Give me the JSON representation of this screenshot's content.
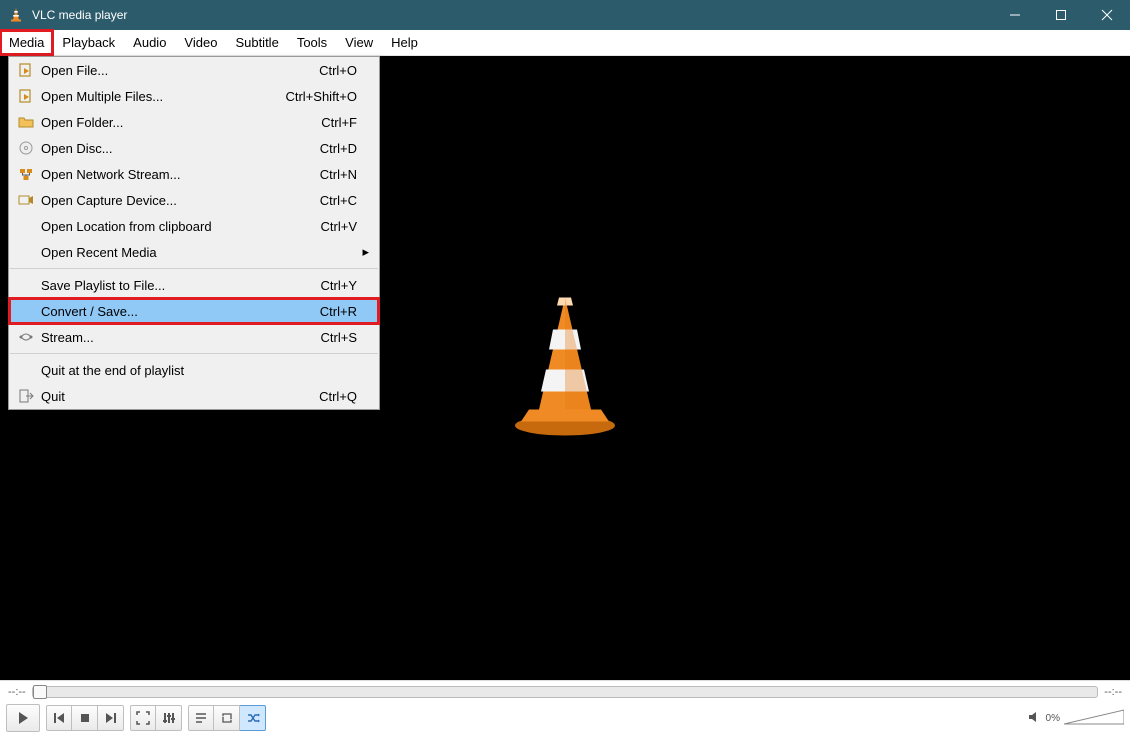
{
  "titlebar": {
    "title": "VLC media player"
  },
  "menubar": {
    "items": [
      "Media",
      "Playback",
      "Audio",
      "Video",
      "Subtitle",
      "Tools",
      "View",
      "Help"
    ],
    "highlighted_index": 0
  },
  "media_menu": {
    "groups": [
      [
        {
          "icon": "file",
          "label": "Open File...",
          "shortcut": "Ctrl+O"
        },
        {
          "icon": "file",
          "label": "Open Multiple Files...",
          "shortcut": "Ctrl+Shift+O"
        },
        {
          "icon": "folder",
          "label": "Open Folder...",
          "shortcut": "Ctrl+F"
        },
        {
          "icon": "disc",
          "label": "Open Disc...",
          "shortcut": "Ctrl+D"
        },
        {
          "icon": "network",
          "label": "Open Network Stream...",
          "shortcut": "Ctrl+N"
        },
        {
          "icon": "capture",
          "label": "Open Capture Device...",
          "shortcut": "Ctrl+C"
        },
        {
          "icon": "",
          "label": "Open Location from clipboard",
          "shortcut": "Ctrl+V"
        },
        {
          "icon": "",
          "label": "Open Recent Media",
          "shortcut": "",
          "submenu": true
        }
      ],
      [
        {
          "icon": "",
          "label": "Save Playlist to File...",
          "shortcut": "Ctrl+Y"
        },
        {
          "icon": "",
          "label": "Convert / Save...",
          "shortcut": "Ctrl+R",
          "highlighted": true
        },
        {
          "icon": "stream",
          "label": "Stream...",
          "shortcut": "Ctrl+S"
        }
      ],
      [
        {
          "icon": "",
          "label": "Quit at the end of playlist",
          "shortcut": ""
        },
        {
          "icon": "quit",
          "label": "Quit",
          "shortcut": "Ctrl+Q"
        }
      ]
    ]
  },
  "seek": {
    "time_left": "--:--",
    "time_right": "--:--"
  },
  "volume": {
    "percent_label": "0%"
  }
}
